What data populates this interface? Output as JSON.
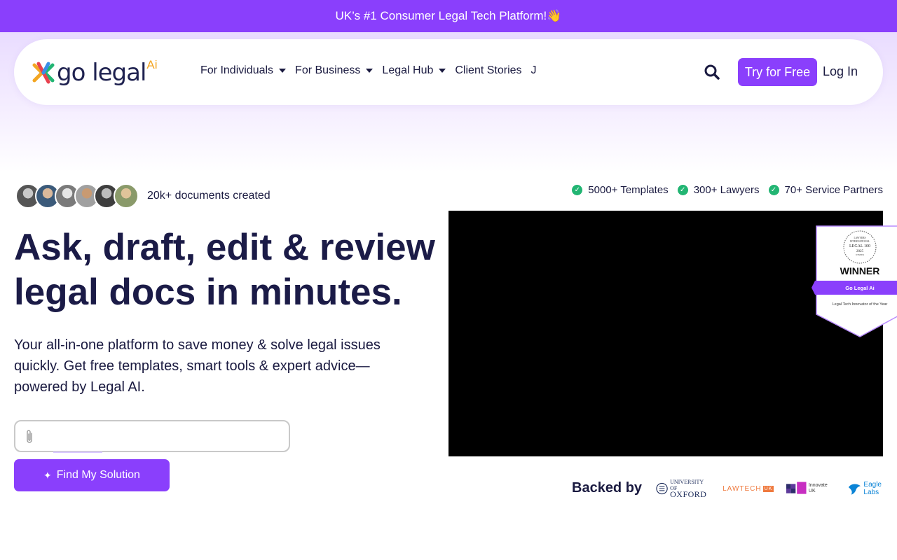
{
  "announcement": {
    "text": "UK’s #1 Consumer Legal Tech Platform!",
    "emoji": "👋"
  },
  "logo": {
    "text": "go legal",
    "suffix": "Ai"
  },
  "nav": {
    "items": [
      {
        "label": "For Individuals",
        "dropdown": true
      },
      {
        "label": "For Business",
        "dropdown": true
      },
      {
        "label": "Legal Hub",
        "dropdown": true
      },
      {
        "label": "Client Stories",
        "dropdown": false
      },
      {
        "label": "J",
        "dropdown": false
      }
    ],
    "try_label": "Try for Free",
    "login_label": "Log In"
  },
  "social_proof": {
    "documents_text": "20k+ documents created"
  },
  "stats": [
    {
      "label": "5000+ Templates"
    },
    {
      "label": "300+ Lawyers"
    },
    {
      "label": "70+ Service Partners"
    }
  ],
  "hero": {
    "headline_line1": "Ask, draft, edit & review",
    "headline_line2": "legal docs in minutes.",
    "subtext": "Your all-in-one platform to save money & solve legal issues quickly. Get free templates, smart tools & expert advice—powered by Legal AI.",
    "cta_label": "Find My Solution"
  },
  "award_badge": {
    "seal_line1": "LAWYERS",
    "seal_line2": "INTERNATIONAL",
    "seal_line3": "LEGAL 100",
    "seal_year": "2025",
    "seal_line4": "WINNER",
    "title": "WINNER",
    "company": "Go Legal Ai",
    "category": "Legal Tech Innovator of the Year"
  },
  "backed_by": {
    "label": "Backed by",
    "oxford_small": "UNIVERSITY OF",
    "oxford_big": "OXFORD",
    "lawtech": "LAWTECH",
    "lawtech_suffix": "UK",
    "innovate": "Innovate UK",
    "eagle": "Eagle Labs"
  },
  "colors": {
    "brand_purple": "#8a3ffc",
    "headline": "#1b1b47",
    "check_green": "#22b573",
    "logo_accent": "#f3a623"
  }
}
